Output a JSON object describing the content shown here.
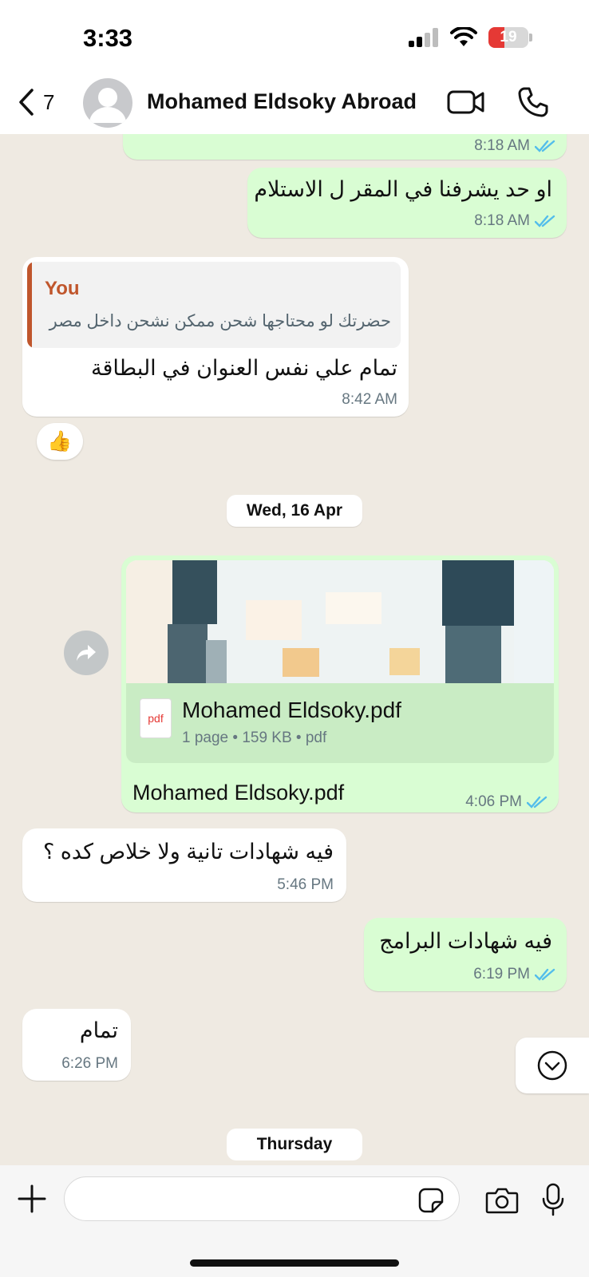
{
  "status_bar": {
    "time": "3:33",
    "battery": "19"
  },
  "header": {
    "back_count": "7",
    "contact_name": "Mohamed Eldsoky Abroad"
  },
  "messages": {
    "m0": {
      "time": "8:18 AM"
    },
    "m1": {
      "text": "او حد يشرفنا في المقر ل الاستلام",
      "time": "8:18 AM"
    },
    "m2": {
      "quote_author": "You",
      "quote_text": "حضرتك لو محتاجها شحن ممكن نشحن داخل مصر",
      "text": "تمام علي نفس العنوان في البطاقة",
      "time": "8:42 AM",
      "reaction": "👍"
    },
    "date_1": "Wed, 16 Apr",
    "m3": {
      "file_icon_label": "pdf",
      "file_name": "Mohamed Eldsoky.pdf",
      "file_meta": "1 page • 159 KB • pdf",
      "caption": "Mohamed Eldsoky.pdf",
      "time": "4:06 PM"
    },
    "m4": {
      "text": "فيه شهادات تانية ولا خلاص كده ؟",
      "time": "5:46 PM"
    },
    "m5": {
      "text": "فيه شهادات البرامج",
      "time": "6:19 PM"
    },
    "m6": {
      "text": "تمام",
      "time": "6:26 PM"
    },
    "date_2": "Thursday"
  },
  "composer": {
    "placeholder": ""
  },
  "colors": {
    "outgoing_bubble": "#d9fdd3",
    "incoming_bubble": "#ffffff",
    "read_ticks": "#53bdeb",
    "quote_accent": "#c0562c",
    "background": "#efeae2"
  }
}
